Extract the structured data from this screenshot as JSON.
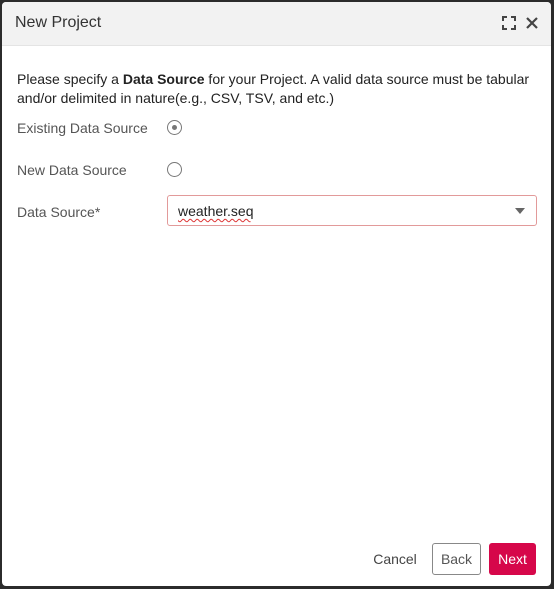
{
  "dialog": {
    "title": "New Project"
  },
  "intro": {
    "prefix": "Please specify a ",
    "bold": "Data Source",
    "suffix": " for your Project. A valid data source must be tabular and/or delimited in nature(e.g., CSV, TSV, and etc.)"
  },
  "options": {
    "existing_label": "Existing Data Source",
    "existing_selected": true,
    "new_label": "New Data Source",
    "new_selected": false
  },
  "data_source": {
    "label": "Data Source*",
    "value": "weather.seq"
  },
  "footer": {
    "cancel_label": "Cancel",
    "back_label": "Back",
    "next_label": "Next"
  },
  "colors": {
    "accent": "#d6074a",
    "field_border": "#e29a9a",
    "titlebar_bg": "#f2f2f2"
  },
  "icons": {
    "maximize": "maximize-icon",
    "close": "close-icon",
    "dropdown": "chevron-down-icon"
  }
}
